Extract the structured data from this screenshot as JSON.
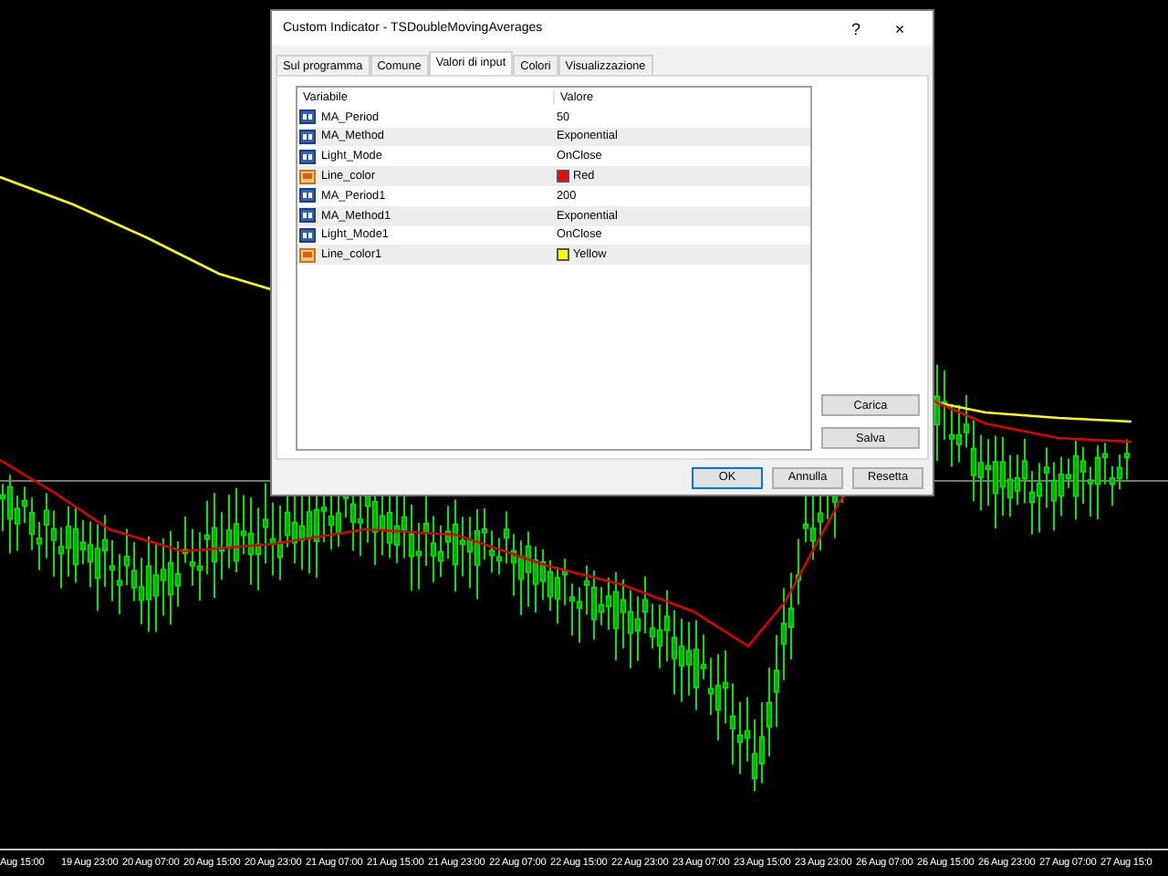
{
  "window": {
    "title": "Custom Indicator - TSDoubleMovingAverages",
    "help": "?",
    "close": "×"
  },
  "tabs": [
    {
      "label": "Sul programma",
      "selected": false
    },
    {
      "label": "Comune",
      "selected": false
    },
    {
      "label": "Valori di input",
      "selected": true
    },
    {
      "label": "Colori",
      "selected": false
    },
    {
      "label": "Visualizzazione",
      "selected": false
    }
  ],
  "table": {
    "columns": [
      "Variabile",
      "Valore"
    ],
    "rows": [
      {
        "kind": "value",
        "name": "MA_Period",
        "value": "50"
      },
      {
        "kind": "value",
        "name": "MA_Method",
        "value": "Exponential"
      },
      {
        "kind": "value",
        "name": "Light_Mode",
        "value": "OnClose"
      },
      {
        "kind": "color",
        "name": "Line_color",
        "value": "Red",
        "color": "#ff0000"
      },
      {
        "kind": "value",
        "name": "MA_Period1",
        "value": "200"
      },
      {
        "kind": "value",
        "name": "MA_Method1",
        "value": "Exponential"
      },
      {
        "kind": "value",
        "name": "Light_Mode1",
        "value": "OnClose"
      },
      {
        "kind": "color",
        "name": "Line_color1",
        "value": "Yellow",
        "color": "#ffff00"
      }
    ]
  },
  "side_buttons": [
    "Carica",
    "Salva"
  ],
  "footer_buttons": [
    {
      "label": "OK",
      "default": true
    },
    {
      "label": "Annulla",
      "default": false
    },
    {
      "label": "Resetta",
      "default": false
    }
  ],
  "time_axis": [
    "Aug 15:00",
    "19 Aug 23:00",
    "20 Aug 07:00",
    "20 Aug 15:00",
    "20 Aug 23:00",
    "21 Aug 07:00",
    "21 Aug 15:00",
    "21 Aug 23:00",
    "22 Aug 07:00",
    "22 Aug 15:00",
    "22 Aug 23:00",
    "23 Aug 07:00",
    "23 Aug 15:00",
    "23 Aug 23:00",
    "26 Aug 07:00",
    "26 Aug 15:00",
    "26 Aug 23:00",
    "27 Aug 07:00",
    "27 Aug 15:0"
  ]
}
